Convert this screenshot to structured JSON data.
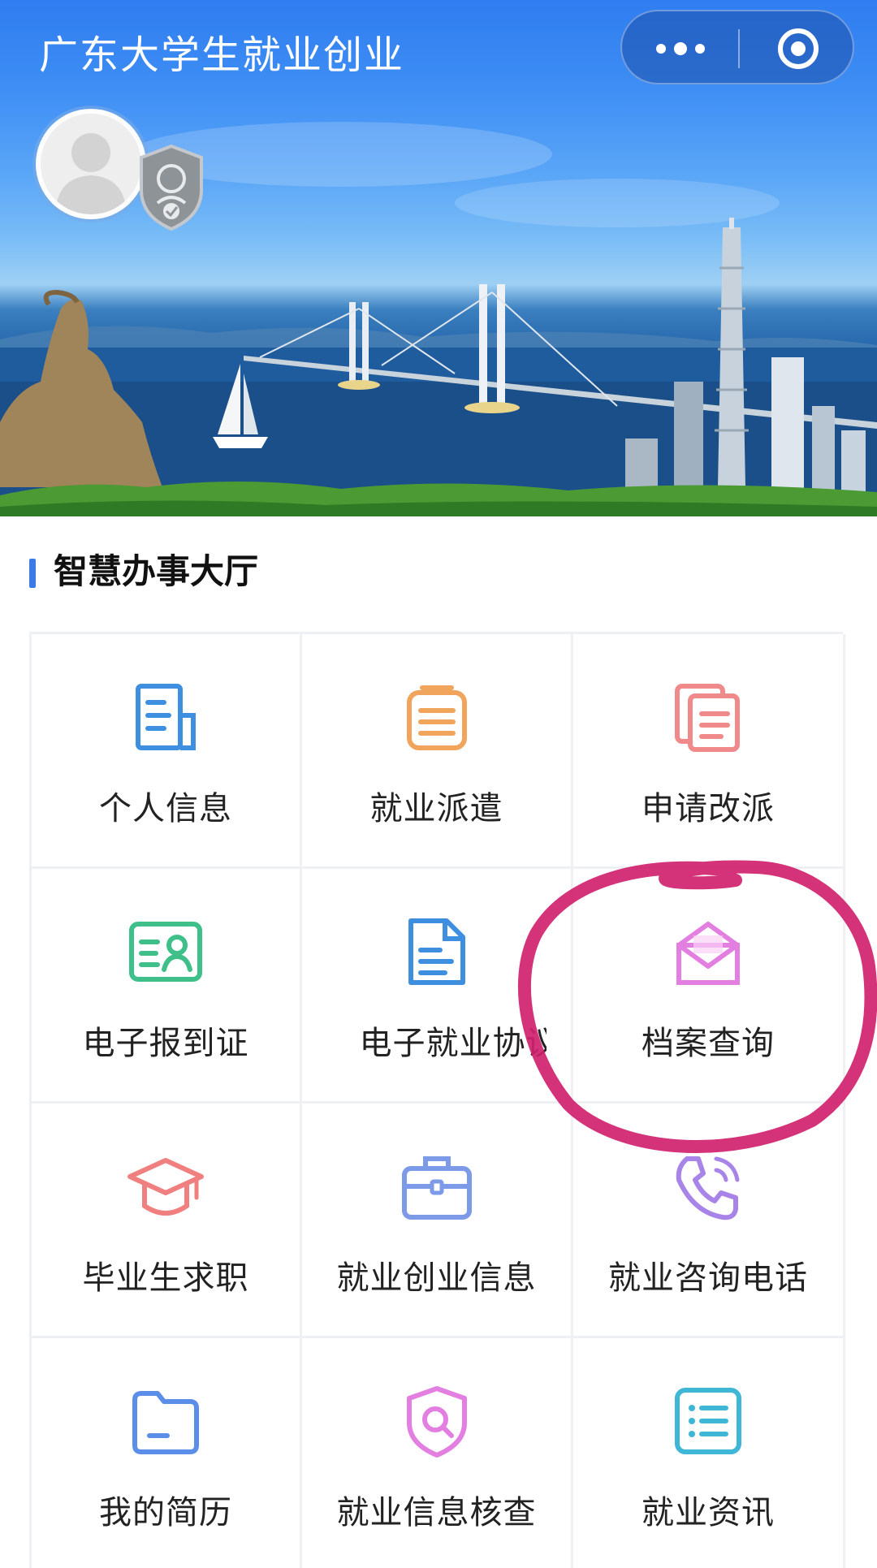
{
  "header": {
    "app_title": "广东大学生就业创业",
    "more_icon": "more-dots-icon",
    "close_icon": "target-circle-icon"
  },
  "profile": {
    "avatar_icon": "default-avatar-icon",
    "badge_icon": "verified-shield-icon"
  },
  "section": {
    "title": "智慧办事大厅",
    "accent_color": "#3b7be8"
  },
  "services": [
    {
      "label": "个人信息",
      "icon": "document-icon",
      "color": "#3f8fe0"
    },
    {
      "label": "就业派遣",
      "icon": "clipboard-list-icon",
      "color": "#f0a45c"
    },
    {
      "label": "申请改派",
      "icon": "stacked-documents-icon",
      "color": "#f08a8a"
    },
    {
      "label": "电子报到证",
      "icon": "id-card-icon",
      "color": "#3fc08a"
    },
    {
      "label": "电子就业协议",
      "icon": "agreement-file-icon",
      "color": "#3f8fe0"
    },
    {
      "label": "档案查询",
      "icon": "open-envelope-icon",
      "color": "#e27fe0"
    },
    {
      "label": "毕业生求职",
      "icon": "graduation-cap-icon",
      "color": "#f07f7f"
    },
    {
      "label": "就业创业信息",
      "icon": "briefcase-icon",
      "color": "#7c9ae8"
    },
    {
      "label": "就业咨询电话",
      "icon": "phone-icon",
      "color": "#a884e8"
    },
    {
      "label": "我的简历",
      "icon": "folder-icon",
      "color": "#5a8ee8"
    },
    {
      "label": "就业信息核查",
      "icon": "shield-search-icon",
      "color": "#e27fe0"
    },
    {
      "label": "就业资讯",
      "icon": "list-icon",
      "color": "#3fb6d6"
    }
  ],
  "annotation": {
    "type": "hand-drawn-circle",
    "target": "档案查询",
    "color": "#d0216e"
  }
}
